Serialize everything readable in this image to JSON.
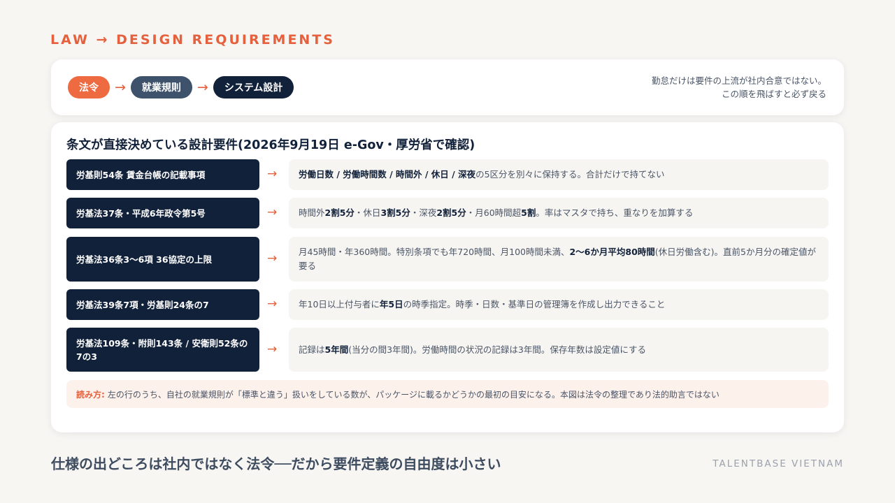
{
  "header": {
    "eyebrow": "LAW → DESIGN REQUIREMENTS"
  },
  "flow": {
    "steps": [
      "法令",
      "就業規則",
      "システム設計"
    ],
    "arrow": "→",
    "note_lines": [
      "勤怠だけは要件の上流が社内合意ではない。",
      "この順を飛ばすと必ず戻る"
    ]
  },
  "requirements": {
    "title": "条文が直接決めている設計要件(2026年9月19日 e-Gov・厚労省で確認)",
    "rows": [
      {
        "label": "労基則54条 賃金台帳の記載事項",
        "desc": [
          {
            "t": "労働日数 / 労働時間数 / 時間外 / 休日 / 深夜",
            "b": true
          },
          {
            "t": "の5区分を別々に保持する。合計だけで持てない"
          }
        ]
      },
      {
        "label": "労基法37条・平成6年政令第5号",
        "desc": [
          {
            "t": "時間外"
          },
          {
            "t": "2割5分",
            "b": true
          },
          {
            "t": "・休日"
          },
          {
            "t": "3割5分",
            "b": true
          },
          {
            "t": "・深夜"
          },
          {
            "t": "2割5分",
            "b": true
          },
          {
            "t": "・月60時間超"
          },
          {
            "t": "5割",
            "b": true
          },
          {
            "t": "。率はマスタで持ち、重なりを加算する"
          }
        ]
      },
      {
        "label": "労基法36条3〜6項 36協定の上限",
        "desc": [
          {
            "t": "月45時間・年360時間。特別条項でも年720時間、月100時間未満、"
          },
          {
            "t": "2〜6か月平均80時間",
            "b": true
          },
          {
            "t": "(休日労働含む)。直前5か月分の確定値が要る"
          }
        ]
      },
      {
        "label": "労基法39条7項・労基則24条の7",
        "desc": [
          {
            "t": "年10日以上付与者に"
          },
          {
            "t": "年5日",
            "b": true
          },
          {
            "t": "の時季指定。時季・日数・基準日の管理簿を作成し出力できること"
          }
        ]
      },
      {
        "label": "労基法109条・附則143条 / 安衛則52条の7の3",
        "desc": [
          {
            "t": "記録は"
          },
          {
            "t": "5年間",
            "b": true
          },
          {
            "t": "(当分の間3年間)。労働時間の状況の記録は3年間。保存年数は設定値にする"
          }
        ]
      }
    ],
    "reading": {
      "label": "読み方:",
      "text": "左の行のうち、自社の就業規則が「標準と違う」扱いをしている数が、パッケージに載るかどうかの最初の目安になる。本図は法令の整理であり法的助言ではない"
    }
  },
  "footer": {
    "title": "仕様の出どころは社内ではなく法令──だから要件定義の自由度は小さい",
    "brand": "TALENTBASE VIETNAM"
  }
}
